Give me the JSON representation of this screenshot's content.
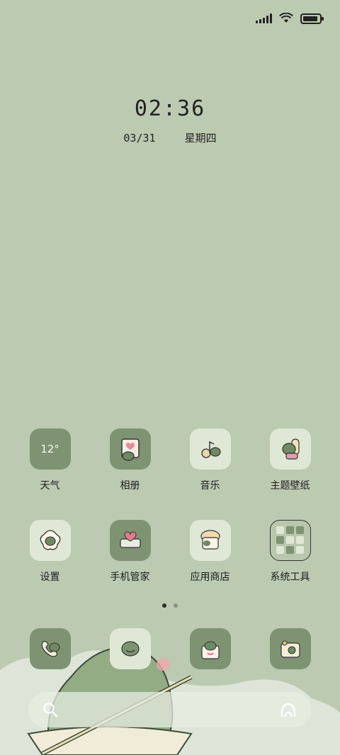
{
  "status_bar": {
    "signal_icon": "signal-icon",
    "wifi_icon": "wifi-icon",
    "battery_icon": "battery-icon",
    "battery_level": 0.9
  },
  "clock": {
    "time": "02:36",
    "date": "03/31",
    "weekday": "星期四"
  },
  "home_grid": {
    "row1": [
      {
        "label": "天气",
        "icon": "weather-icon",
        "temp": "12°",
        "style": "dark"
      },
      {
        "label": "相册",
        "icon": "gallery-icon",
        "style": "dark"
      },
      {
        "label": "音乐",
        "icon": "music-icon",
        "style": "light"
      },
      {
        "label": "主题壁纸",
        "icon": "theme-icon",
        "style": "light"
      }
    ],
    "row2": [
      {
        "label": "设置",
        "icon": "settings-icon",
        "style": "light"
      },
      {
        "label": "手机管家",
        "icon": "security-icon",
        "style": "dark"
      },
      {
        "label": "应用商店",
        "icon": "app-store-icon",
        "style": "light"
      },
      {
        "label": "系统工具",
        "icon": "folder-icon",
        "style": "light"
      }
    ]
  },
  "page_indicator": {
    "pages": 2,
    "current": 1
  },
  "dock": [
    {
      "icon": "phone-icon",
      "style": "dark"
    },
    {
      "icon": "messages-icon",
      "style": "light"
    },
    {
      "icon": "browser-icon",
      "style": "dark"
    },
    {
      "icon": "camera-icon",
      "style": "dark"
    }
  ],
  "search_bar": {
    "search_icon": "search-icon",
    "assistant_icon": "assistant-icon"
  },
  "colors": {
    "background": "#bccab2",
    "tile_dark": "#7d9372",
    "tile_light": "#dfe8d4"
  }
}
